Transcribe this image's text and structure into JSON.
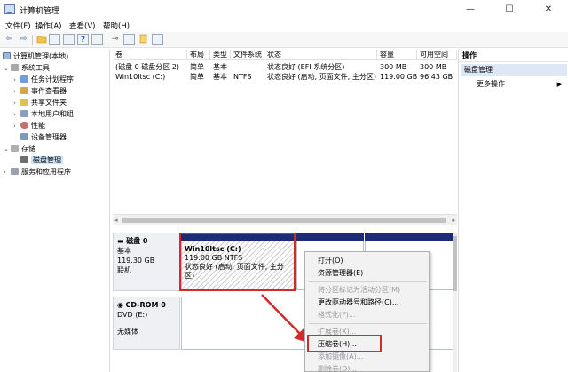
{
  "window": {
    "title": "计算机管理",
    "icon": "computer-management-icon",
    "min_glyph": "—",
    "max_glyph": "☐",
    "close_glyph": "✕"
  },
  "menu": {
    "file": "文件(F)",
    "action": "操作(A)",
    "view": "查看(V)",
    "help": "帮助(H)"
  },
  "toolbar": {
    "icons": [
      "back-arrow-icon",
      "forward-arrow-icon",
      "up-folder-icon",
      "show-hide-tree-icon",
      "properties-icon",
      "help-icon",
      "connect-icon",
      "delete-icon",
      "open-folder-icon",
      "search-icon",
      "export-icon"
    ],
    "back_glyph": "⇦",
    "forward_glyph": "⇨"
  },
  "tree": {
    "root": "计算机管理(本地)",
    "system_tools": "系统工具",
    "task_scheduler": "任务计划程序",
    "event_viewer": "事件查看器",
    "shared_folders": "共享文件夹",
    "local_users": "本地用户和组",
    "performance": "性能",
    "device_manager": "设备管理器",
    "storage": "存储",
    "disk_management": "磁盘管理",
    "services_apps": "服务和应用程序",
    "expanded_glyph": "⌄",
    "collapsed_glyph": "›"
  },
  "volume_table": {
    "headers": [
      "卷",
      "布局",
      "类型",
      "文件系统",
      "状态",
      "容量",
      "可用空间"
    ],
    "rows": [
      [
        "(磁盘 0 磁盘分区 2)",
        "简单",
        "基本",
        "",
        "状态良好 (EFI 系统分区)",
        "300 MB",
        "300 MB"
      ],
      [
        "Win10ltsc (C:)",
        "简单",
        "基本",
        "NTFS",
        "状态良好 (启动, 页面文件, 主分区)",
        "119.00 GB",
        "96.43 GB"
      ]
    ]
  },
  "disks": {
    "disk0": {
      "title": "磁盘 0",
      "type": "基本",
      "size": "119.30 GB",
      "status": "联机"
    },
    "cdrom0": {
      "title": "CD-ROM 0",
      "drive": "DVD (E:)",
      "status": "无媒体"
    },
    "partition_c": {
      "name": "Win10ltsc  (C:)",
      "size": "119.00 GB NTFS",
      "status": "状态良好 (启动, 页面文件, 主分区)"
    }
  },
  "context_menu": {
    "open": "打开(O)",
    "explorer": "资源管理器(E)",
    "mark_active": "将分区标记为活动分区(M)",
    "change_letter": "更改驱动器号和路径(C)...",
    "format": "格式化(F)...",
    "extend": "扩展卷(X)...",
    "shrink": "压缩卷(H)...",
    "add_mirror": "添加镜像(A)...",
    "delete": "删除卷(D)..."
  },
  "actions": {
    "header": "操作",
    "section": "磁盘管理",
    "more": "更多操作"
  },
  "colors": {
    "partition_bar": "#1c2b7a",
    "highlight": "#d42a2a",
    "selected": "#cce4f7",
    "action_section": "#dde8f4"
  }
}
